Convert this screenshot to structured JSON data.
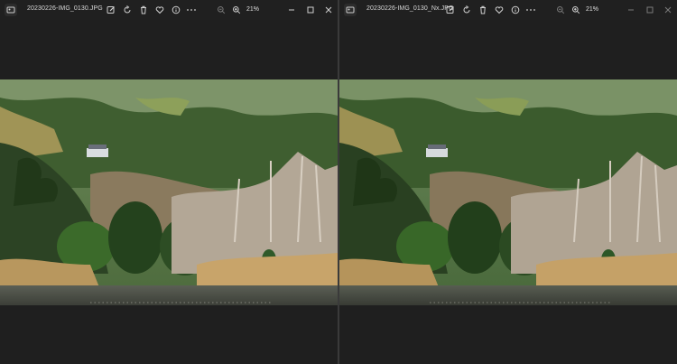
{
  "windows": [
    {
      "id": "left",
      "filename": "20230226-IMG_0130.JPG",
      "zoom": "21%",
      "toolbar": [
        "edit-image-icon",
        "rotate-icon",
        "delete-icon",
        "favorite-heart-icon",
        "info-icon",
        "more-options-icon"
      ],
      "zoom_controls": [
        "zoom-out-icon",
        "zoom-in-icon"
      ],
      "window_controls": [
        "minimize-icon",
        "maximize-icon",
        "close-icon"
      ]
    },
    {
      "id": "right",
      "filename": "20230226-IMG_0130_Nx.JPG",
      "zoom": "21%",
      "toolbar": [
        "edit-image-icon",
        "rotate-icon",
        "delete-icon",
        "favorite-heart-icon",
        "info-icon",
        "more-options-icon"
      ],
      "zoom_controls": [
        "zoom-out-icon",
        "zoom-in-icon"
      ],
      "window_controls": [
        "minimize-icon",
        "maximize-icon",
        "close-icon"
      ]
    }
  ],
  "colors": {
    "titlebar": "#202020",
    "canvas": "#1f1f1f",
    "icon": "#d0d0d0",
    "icon_dim": "#7a7a7a"
  }
}
